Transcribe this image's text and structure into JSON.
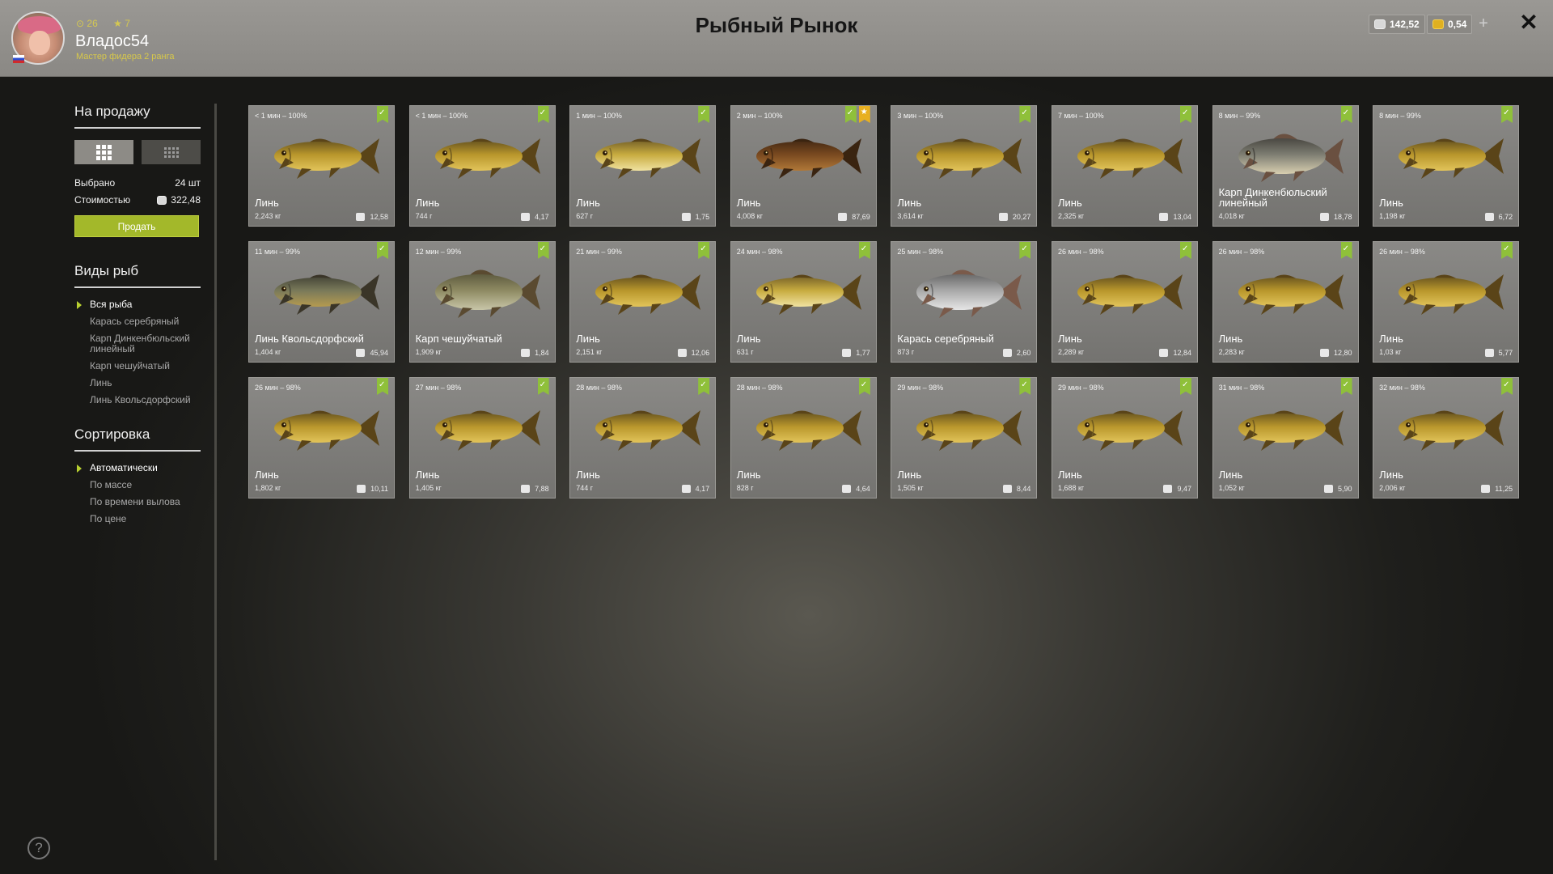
{
  "header": {
    "title": "Рыбный Рынок",
    "username": "Владос54",
    "rank": "Мастер фидера 2 ранга",
    "level": "26",
    "stars": "7",
    "silver": "142,52",
    "gold": "0,54",
    "plus": "+",
    "close": "✕"
  },
  "sidebar": {
    "for_sale_title": "На продажу",
    "selected_label": "Выбрано",
    "selected_value": "24 шт",
    "cost_label": "Стоимостью",
    "cost_value": "322,48",
    "sell_button": "Продать",
    "species_title": "Виды рыб",
    "species": [
      "Вся рыба",
      "Карась серебряный",
      "Карп Динкенбюльский линейный",
      "Карп чешуйчатый",
      "Линь",
      "Линь Квольсдорфский"
    ],
    "sort_title": "Сортировка",
    "sort": [
      "Автоматически",
      "По массе",
      "По времени вылова",
      "По цене"
    ]
  },
  "help": "?",
  "colors": {
    "accent_green": "#a3b82a",
    "check_green": "#8fc03a",
    "star_orange": "#e8b020"
  },
  "fish": [
    {
      "time": "< 1 мин – 100%",
      "name": "Линь",
      "weight": "2,243 кг",
      "price": "12,58",
      "kind": "tench"
    },
    {
      "time": "< 1 мин – 100%",
      "name": "Линь",
      "weight": "744 г",
      "price": "4,17",
      "kind": "tench"
    },
    {
      "time": "1 мин – 100%",
      "name": "Линь",
      "weight": "627 г",
      "price": "1,75",
      "kind": "tench-pale"
    },
    {
      "time": "2 мин – 100%",
      "name": "Линь",
      "weight": "4,008 кг",
      "price": "87,69",
      "kind": "tench-dark",
      "star": true
    },
    {
      "time": "3 мин – 100%",
      "name": "Линь",
      "weight": "3,614 кг",
      "price": "20,27",
      "kind": "tench"
    },
    {
      "time": "7 мин – 100%",
      "name": "Линь",
      "weight": "2,325 кг",
      "price": "13,04",
      "kind": "tench"
    },
    {
      "time": "8 мин – 99%",
      "name": "Карп Динкенбюльский линейный",
      "weight": "4,018 кг",
      "price": "18,78",
      "kind": "mirror-carp"
    },
    {
      "time": "8 мин – 99%",
      "name": "Линь",
      "weight": "1,198 кг",
      "price": "6,72",
      "kind": "tench"
    },
    {
      "time": "11 мин – 99%",
      "name": "Линь Квольсдорфский",
      "weight": "1,404 кг",
      "price": "45,94",
      "kind": "tench-grey"
    },
    {
      "time": "12 мин – 99%",
      "name": "Карп чешуйчатый",
      "weight": "1,909 кг",
      "price": "1,84",
      "kind": "carp"
    },
    {
      "time": "21 мин – 99%",
      "name": "Линь",
      "weight": "2,151 кг",
      "price": "12,06",
      "kind": "tench"
    },
    {
      "time": "24 мин – 98%",
      "name": "Линь",
      "weight": "631 г",
      "price": "1,77",
      "kind": "tench-pale"
    },
    {
      "time": "25 мин – 98%",
      "name": "Карась серебряный",
      "weight": "873 г",
      "price": "2,60",
      "kind": "crucian"
    },
    {
      "time": "26 мин – 98%",
      "name": "Линь",
      "weight": "2,289 кг",
      "price": "12,84",
      "kind": "tench"
    },
    {
      "time": "26 мин – 98%",
      "name": "Линь",
      "weight": "2,283 кг",
      "price": "12,80",
      "kind": "tench"
    },
    {
      "time": "26 мин – 98%",
      "name": "Линь",
      "weight": "1,03 кг",
      "price": "5,77",
      "kind": "tench"
    },
    {
      "time": "26 мин – 98%",
      "name": "Линь",
      "weight": "1,802 кг",
      "price": "10,11",
      "kind": "tench"
    },
    {
      "time": "27 мин – 98%",
      "name": "Линь",
      "weight": "1,405 кг",
      "price": "7,88",
      "kind": "tench"
    },
    {
      "time": "28 мин – 98%",
      "name": "Линь",
      "weight": "744 г",
      "price": "4,17",
      "kind": "tench"
    },
    {
      "time": "28 мин – 98%",
      "name": "Линь",
      "weight": "828 г",
      "price": "4,64",
      "kind": "tench"
    },
    {
      "time": "29 мин – 98%",
      "name": "Линь",
      "weight": "1,505 кг",
      "price": "8,44",
      "kind": "tench"
    },
    {
      "time": "29 мин – 98%",
      "name": "Линь",
      "weight": "1,688 кг",
      "price": "9,47",
      "kind": "tench"
    },
    {
      "time": "31 мин – 98%",
      "name": "Линь",
      "weight": "1,052 кг",
      "price": "5,90",
      "kind": "tench"
    },
    {
      "time": "32 мин – 98%",
      "name": "Линь",
      "weight": "2,006 кг",
      "price": "11,25",
      "kind": "tench"
    }
  ]
}
